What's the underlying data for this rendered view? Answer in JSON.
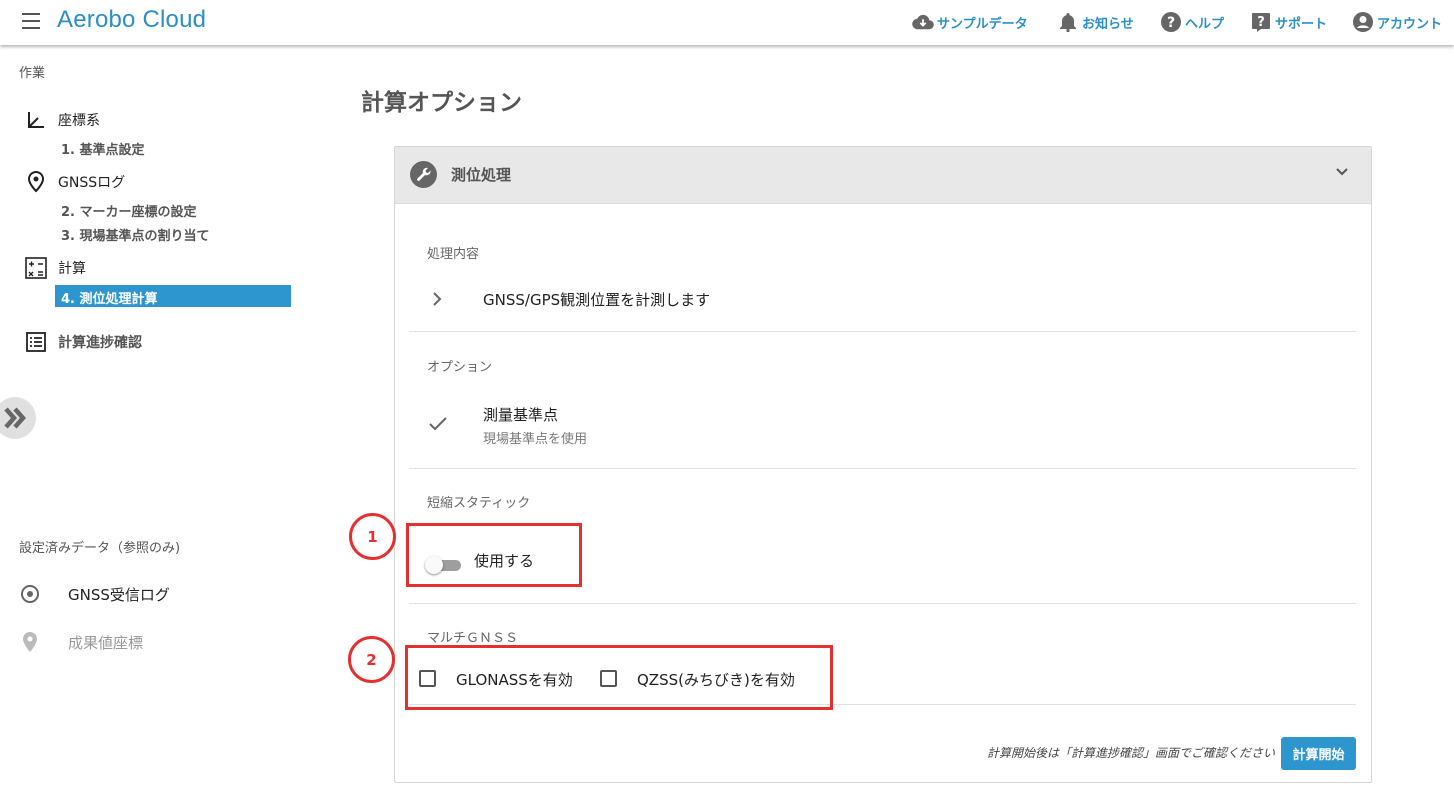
{
  "app": {
    "title": "Aerobo Cloud"
  },
  "topnav": [
    {
      "label": "サンプルデータ",
      "icon": "cloud-download-icon"
    },
    {
      "label": "お知らせ",
      "icon": "bell-icon"
    },
    {
      "label": "ヘルプ",
      "icon": "help-circle-icon"
    },
    {
      "label": "サポート",
      "icon": "help-box-icon"
    },
    {
      "label": "アカウント",
      "icon": "account-icon"
    }
  ],
  "sidebar": {
    "section_title": "作業",
    "groups": [
      {
        "label": "座標系",
        "icon": "axis-icon"
      },
      {
        "label": "GNSSログ",
        "icon": "location-pin-icon"
      },
      {
        "label": "計算",
        "icon": "calculator-icon"
      },
      {
        "label": "計算進捗確認",
        "icon": "list-icon"
      }
    ],
    "subs": [
      {
        "label": "1. 基準点設定"
      },
      {
        "label": "2. マーカー座標の設定"
      },
      {
        "label": "3. 現場基準点の割り当て"
      },
      {
        "label": "4. 測位処理計算",
        "active": true
      }
    ],
    "ref_title": "設定済みデータ（参照のみ)",
    "ref_items": [
      {
        "label": "GNSS受信ログ",
        "icon": "radio-target-icon"
      },
      {
        "label": "成果値座標",
        "icon": "map-marker-icon",
        "disabled": true
      }
    ]
  },
  "main": {
    "title": "計算オプション",
    "card": {
      "header": "測位処理",
      "process_label": "処理内容",
      "process_text": "GNSS/GPS観測位置を計測します",
      "option_label": "オプション",
      "option_item": "測量基準点",
      "option_sub": "現場基準点を使用",
      "static_label": "短縮スタティック",
      "static_toggle_label": "使用する",
      "static_toggle_on": false,
      "multi_label": "マルチＧＮＳＳ",
      "glonass_label": "GLONASSを有効",
      "glonass_checked": false,
      "qzss_label": "QZSS(みちびき)を有効",
      "qzss_checked": false,
      "note": "計算開始後は「計算進捗確認」画面でご確認ください",
      "start_button": "計算開始"
    }
  },
  "annotations": {
    "one": "1",
    "two": "2",
    "color": "#e53030"
  },
  "colors": {
    "accent": "#2e96cf",
    "brand": "#2b8fc6"
  }
}
